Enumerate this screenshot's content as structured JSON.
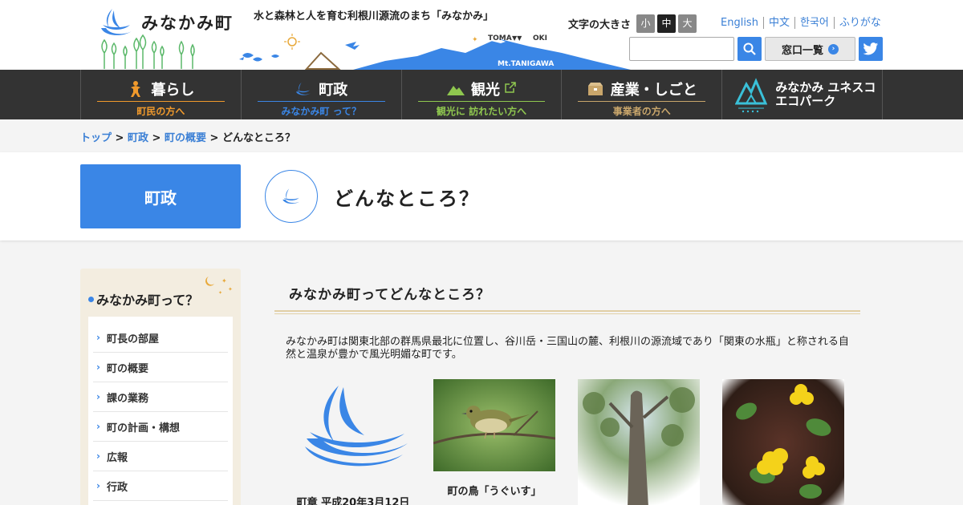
{
  "header": {
    "logo_text": "みなかみ町",
    "tagline": "水と森林と人を育む利根川源流のまち「みなかみ」",
    "deco_labels": {
      "toma": "TOMA",
      "oki": "OKI",
      "mountain": "Mt.TANIGAWA"
    },
    "text_size": {
      "label": "文字の大きさ",
      "small": "小",
      "medium": "中",
      "large": "大",
      "active": "中"
    },
    "languages": [
      "English",
      "中文",
      "한국어",
      "ふりがな"
    ],
    "search": {
      "placeholder": "",
      "value": ""
    },
    "madoguchi_label": "窓口一覧",
    "icons": {
      "search": "search-icon",
      "twitter": "twitter-icon",
      "arrow": "arrow-right-icon"
    }
  },
  "nav": {
    "items": [
      {
        "label": "暮らし",
        "sub": "町民の方へ",
        "icon": "person-icon",
        "color": "#f19a2c"
      },
      {
        "label": "町政",
        "sub": "みなかみ町 って？",
        "icon": "town-emblem-icon",
        "color": "#3a86e6"
      },
      {
        "label": "観光",
        "sub": "観光に 訪れたい方へ",
        "icon": "mountain-icon",
        "color": "#8fc74f",
        "external": true
      },
      {
        "label": "産業・しごと",
        "sub": "事業者の方へ",
        "icon": "box-icon",
        "color": "#c9a66b"
      }
    ],
    "eco": {
      "line1": "みなかみ ユネスコ",
      "line2": "エコパーク",
      "icon": "ecopark-logo"
    }
  },
  "breadcrumb": {
    "items": [
      "トップ",
      "町政",
      "町の概要"
    ],
    "current": "どんなところ？",
    "separator": ">"
  },
  "title_band": {
    "category": "町政",
    "page_title": "どんなところ？",
    "emblem_icon": "town-emblem-icon"
  },
  "sidebar": {
    "heading": "みなかみ町って？",
    "items": [
      "町長の部屋",
      "町の概要",
      "課の業務",
      "町の計画・構想",
      "広報",
      "行政"
    ]
  },
  "main": {
    "section_title": "みなかみ町ってどんなところ？",
    "intro": "みなかみ町は関東北部の群馬県最北に位置し、谷川岳・三国山の麓、利根川の源流域であり「関東の水瓶」と称される自然と温泉が豊かで風光明媚な町です。",
    "cards": [
      {
        "caption": "町章 平成20年3月12日",
        "image": "town-emblem"
      },
      {
        "caption": "町の鳥「うぐいす」",
        "image": "bush-warbler-photo"
      },
      {
        "caption": "",
        "image": "tree-photo"
      },
      {
        "caption": "",
        "image": "yellow-flower-photo"
      }
    ]
  },
  "colors": {
    "accent": "#3a86e6",
    "nav_bg": "#333333",
    "kurashi": "#f19a2c",
    "kanko": "#8fc74f",
    "sangyo": "#c9a66b",
    "sidebar_bg": "#f3ede0"
  }
}
